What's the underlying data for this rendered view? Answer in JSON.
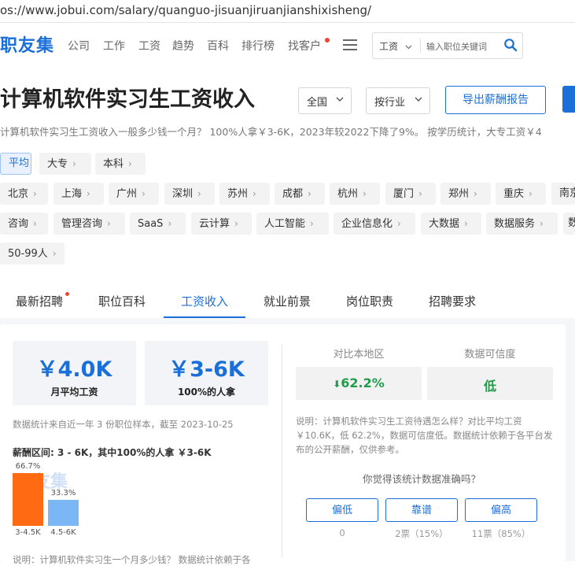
{
  "url": "os://www.jobui.com/salary/quanguo-jisuanjiruanjianshixisheng/",
  "nav": {
    "logo": "职友集",
    "items": [
      "公司",
      "工作",
      "工资",
      "趋势",
      "百科",
      "排行榜",
      "找客户"
    ],
    "search_category": "工资",
    "search_placeholder": "输入职位关键词"
  },
  "header": {
    "title": "计算机软件实习生工资收入",
    "region_select": "全国",
    "industry_select": "按行业",
    "export_button": "导出薪酬报告"
  },
  "summary": "计算机软件实习生工资收入一般多少钱一个月？ 100%人拿￥3-6K，2023年较2022下降了9%。 按学历统计，大专工资￥4",
  "filters": {
    "education": [
      "平均",
      "大专",
      "本科"
    ],
    "cities": [
      "北京",
      "上海",
      "广州",
      "深圳",
      "苏州",
      "成都",
      "杭州",
      "厦门",
      "郑州",
      "重庆",
      "南京"
    ],
    "industries": [
      "咨询",
      "管理咨询",
      "SaaS",
      "云计算",
      "人工智能",
      "企业信息化",
      "大数据",
      "数据服务",
      "数"
    ],
    "company_size": [
      "50-99人"
    ]
  },
  "tabs": [
    "最新招聘",
    "职位百科",
    "工资收入",
    "就业前景",
    "岗位职责",
    "招聘要求"
  ],
  "active_tab": 2,
  "stats": {
    "avg_value": "￥4.0K",
    "avg_label": "月平均工资",
    "range_value": "￥3-6K",
    "range_label": "100%的人拿",
    "source_note": "数据统计来自近一年 3 份职位样本，截至 2023-10-25",
    "range_heading": "薪酬区间: 3 - 6K，其中100%的人拿 ￥3-6K"
  },
  "distribution": {
    "watermark": "职友集",
    "bars": [
      {
        "label": "3-4.5K",
        "percent": 66.7,
        "percent_text": "66.7%",
        "color": "#ff6a13"
      },
      {
        "label": "4.5-6K",
        "percent": 33.3,
        "percent_text": "33.3%",
        "color": "#7bb6f5"
      }
    ],
    "bottom_note": "说明：计算机软件实习生一个月多少钱？ 数据统计依赖于各"
  },
  "compare": {
    "local_label": "对比本地区",
    "local_value": "62.2%",
    "reliability_label": "数据可信度",
    "reliability_value": "低",
    "description": "说明：计算机软件实习生工资待遇怎么样？对比平均工资￥10.6K，低 62.2%，数据可信度低。数据统计依赖于各平台发布的公开薪酬，仅供参考。",
    "question": "你觉得该统计数据准确吗？",
    "votes": [
      {
        "label": "偏低",
        "count": "0"
      },
      {
        "label": "靠谱",
        "count": "2票（15%）"
      },
      {
        "label": "偏高",
        "count": "11票（85%）"
      }
    ]
  },
  "colors": {
    "brand": "#1b6fd8",
    "down": "#1f9d4a"
  }
}
